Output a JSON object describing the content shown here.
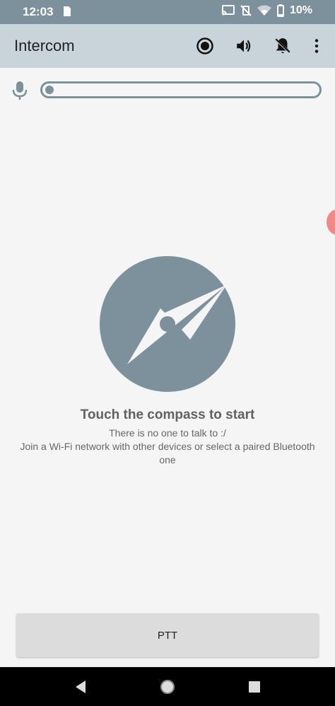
{
  "status_bar": {
    "time": "12:03",
    "battery": "10%"
  },
  "app_bar": {
    "title": "Intercom",
    "icons": [
      "record-icon",
      "volume-icon",
      "notifications-off-icon",
      "more-vert-icon"
    ]
  },
  "mic_level": {
    "icon": "mic-icon",
    "level": 0
  },
  "main": {
    "compass_icon": "compass-icon",
    "headline": "Touch the compass to start",
    "line1": "There is no one to talk to :/",
    "line2": "Join a Wi-Fi network with other devices or select a paired Bluetooth one"
  },
  "ptt_button": {
    "label": "PTT"
  },
  "colors": {
    "primary": "#7d919d",
    "app_bar": "#c9d3da",
    "background": "#f5f5f5",
    "accent_edge": "#f08a8a"
  }
}
